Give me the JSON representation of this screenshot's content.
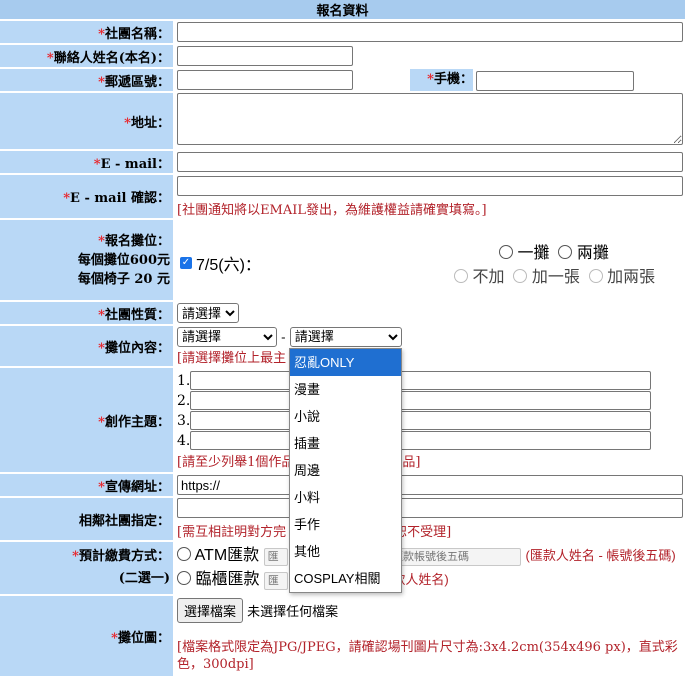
{
  "header": {
    "title": "報名資料"
  },
  "fields": {
    "club_name": {
      "label": "社團名稱："
    },
    "contact_name": {
      "label": "聯絡人姓名(本名)："
    },
    "postal_code": {
      "label": "郵遞區號："
    },
    "mobile": {
      "label": "手機："
    },
    "address": {
      "label": "地址："
    },
    "email": {
      "label": "E - mail："
    },
    "email_confirm": {
      "label": "E - mail 確認：",
      "note": "[社團通知將以EMAIL發出，為維護權益請確實填寫。]"
    },
    "booth": {
      "label": "報名攤位：",
      "sub1": "每個攤位600元",
      "sub2": "每個椅子 20 元",
      "date": "7/5(六)：",
      "opt_one": "一攤",
      "opt_two": "兩攤",
      "chair_none": "不加",
      "chair_one": "加一張",
      "chair_two": "加兩張"
    },
    "club_type": {
      "label": "社團性質：",
      "selected": "請選擇"
    },
    "booth_content": {
      "label": "攤位內容：",
      "select1": "請選擇",
      "dash": "-",
      "select2": "請選擇",
      "note": "[請選擇攤位上最主",
      "options": [
        "忍亂ONLY",
        "漫畫",
        "小說",
        "插畫",
        "周邊",
        "小料",
        "手作",
        "其他",
        "COSPLAY相關"
      ]
    },
    "theme": {
      "label": "創作主題：",
      "n1": "1.",
      "n2": "2.",
      "n3": "3.",
      "n4": "4.",
      "note_start": "[請至少列舉1個作品",
      "note_end": "品]"
    },
    "website": {
      "label": "宣傳網址：",
      "value": "https://"
    },
    "neighbor": {
      "label": "相鄰社團指定：",
      "note_start": "[需互相註明對方完",
      "note_end": "恕不受理]"
    },
    "payment": {
      "label1": "預計繳費方式：",
      "label2": "(二選一)",
      "atm": "ATM匯款",
      "atm_ph1": "匯",
      "atm_ph2": "匯款帳號後五碼",
      "atm_note": "(匯款人姓名 - 帳號後五碼)",
      "counter": "臨櫃匯款",
      "counter_ph": "匯",
      "counter_note": "款人姓名)"
    },
    "booth_image": {
      "label": "攤位圖：",
      "button": "選擇檔案",
      "status": "未選擇任何檔案",
      "note": "[檔案格式限定為JPG/JPEG，請確認場刊圖片尺寸為:3x4.2cm(354x496 px)，直式彩色，300dpi]"
    }
  },
  "colors": {
    "label_bg": "#b9d8f6",
    "header_bg": "#a7cbee",
    "required": "#e8242a",
    "note": "#b2222a",
    "selected": "#1f6fd1"
  }
}
